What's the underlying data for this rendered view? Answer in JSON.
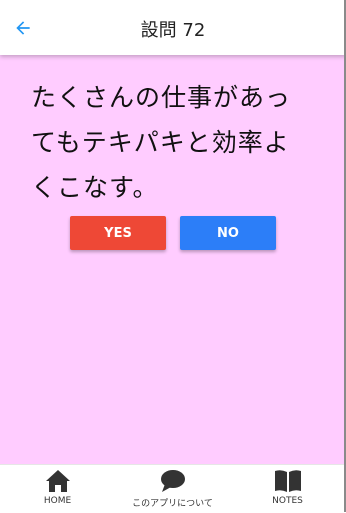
{
  "header": {
    "title": "設問 72",
    "back_icon": "arrow-left-icon"
  },
  "colors": {
    "background": "#ffccff",
    "yes_button": "#ee4836",
    "no_button": "#2c7ef8",
    "back_icon": "#2196f3"
  },
  "question": {
    "line1": "たくさんの仕事があっ",
    "line2": "てもテキパキと効率よ",
    "line3": "くこなす。"
  },
  "buttons": {
    "yes_label": "YES",
    "no_label": "NO"
  },
  "nav": [
    {
      "label": "HOME",
      "icon": "home-icon"
    },
    {
      "label": "このアプリについて",
      "icon": "chat-bubble-icon"
    },
    {
      "label": "NOTES",
      "icon": "book-icon"
    }
  ]
}
